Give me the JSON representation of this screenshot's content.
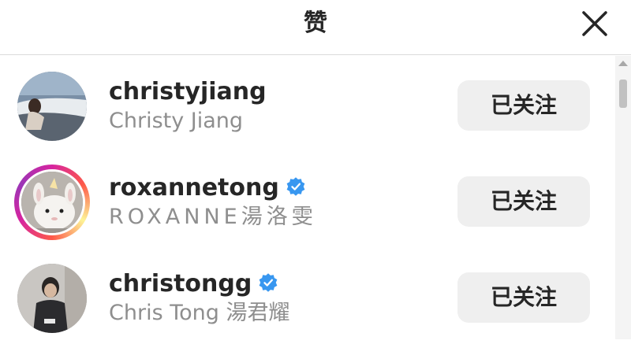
{
  "header": {
    "title": "赞",
    "close_icon": "close-icon"
  },
  "users": [
    {
      "username": "christyjiang",
      "full_name": "Christy Jiang",
      "verified": false,
      "story_ring": false,
      "follow_label": "已关注"
    },
    {
      "username": "roxannetong",
      "full_name": "ROXANNE湯洛雯",
      "verified": true,
      "story_ring": true,
      "follow_label": "已关注"
    },
    {
      "username": "christongg",
      "full_name": "Chris Tong 湯君耀",
      "verified": true,
      "story_ring": false,
      "follow_label": "已关注"
    }
  ],
  "colors": {
    "verified_badge": "#3897f0",
    "button_bg": "#efefef",
    "secondary_text": "#8e8e8e"
  }
}
